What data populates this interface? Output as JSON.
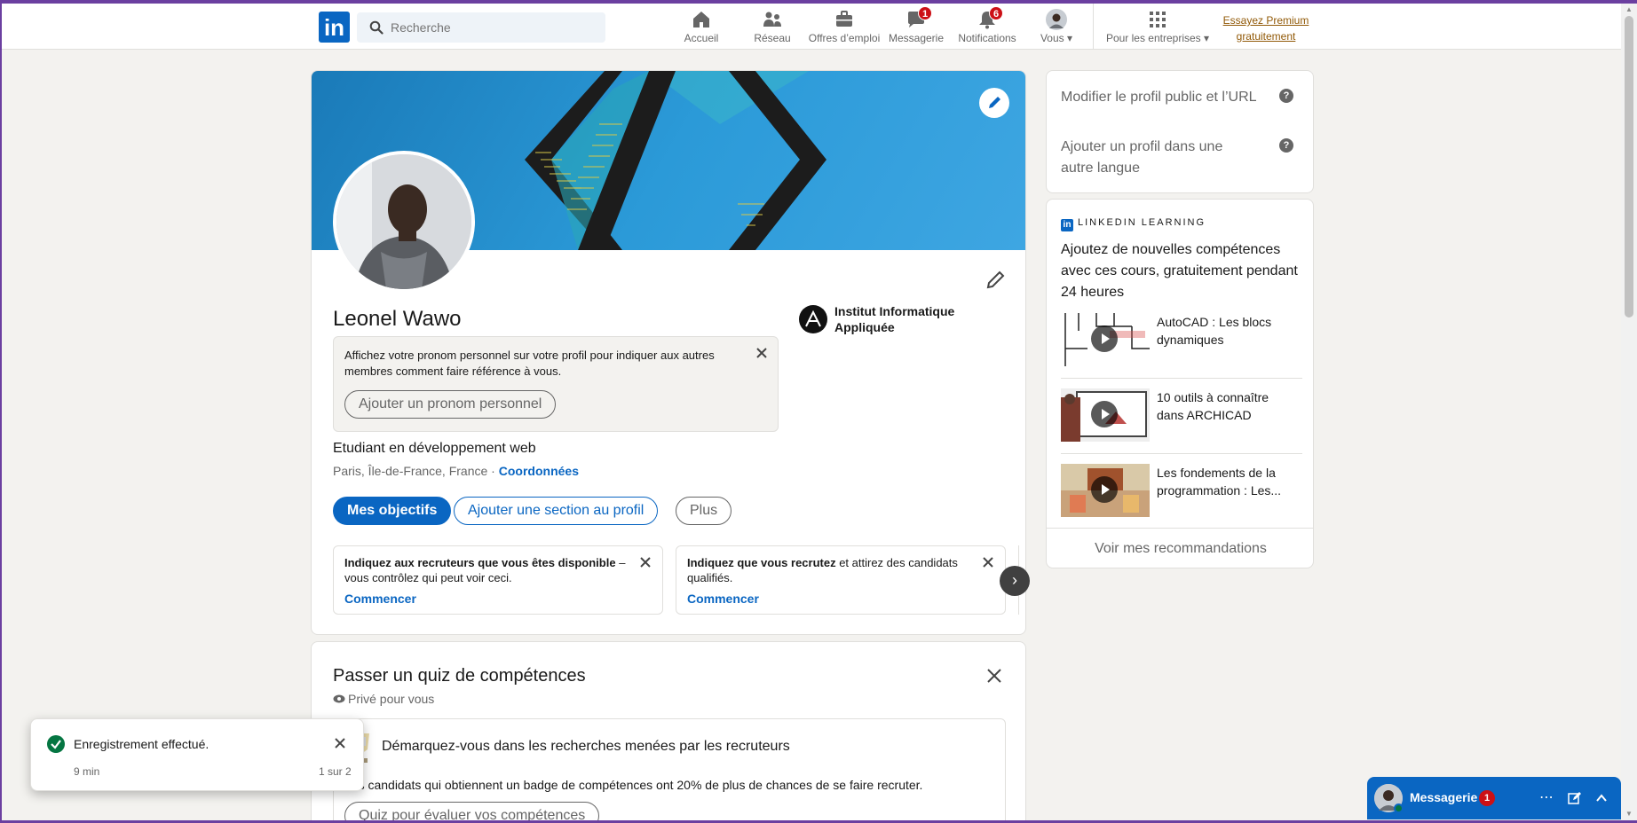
{
  "nav": {
    "search_placeholder": "Recherche",
    "items": [
      {
        "label": "Accueil",
        "icon": "home-icon"
      },
      {
        "label": "Réseau",
        "icon": "network-icon"
      },
      {
        "label": "Offres d’emploi",
        "icon": "jobs-icon"
      },
      {
        "label": "Messagerie",
        "icon": "messaging-icon",
        "badge": "1"
      },
      {
        "label": "Notifications",
        "icon": "bell-icon",
        "badge": "6"
      },
      {
        "label": "Vous",
        "icon": "me-avatar"
      },
      {
        "label": "Pour les entreprises",
        "icon": "grid-icon"
      }
    ],
    "premium_line1": "Essayez Premium",
    "premium_line2": "gratuitement"
  },
  "profile": {
    "name": "Leonel Wawo",
    "school": "Institut Informatique Appliquée",
    "pronoun_text": "Affichez votre pronom personnel sur votre profil pour indiquer aux autres membres comment faire référence à vous.",
    "pronoun_button": "Ajouter un pronom personnel",
    "headline": "Etudiant en développement web",
    "location": "Paris, Île-de-France, France",
    "location_sep": " · ",
    "contact_link": "Coordonnées",
    "btn_goals": "Mes objectifs",
    "btn_add_section": "Ajouter une section au profil",
    "btn_more": "Plus",
    "promo1_bold": "Indiquez aux recruteurs que vous êtes disponible",
    "promo1_rest": " – vous contrôlez qui peut voir ceci.",
    "promo1_cta": "Commencer",
    "promo2_bold": "Indiquez que vous recrutez",
    "promo2_rest": " et attirez des candidats qualifiés.",
    "promo2_cta": "Commencer"
  },
  "quiz": {
    "title": "Passer un quiz de compétences",
    "privacy": "Privé pour vous",
    "inner_title": "Démarquez-vous dans les recherches menées par les recruteurs",
    "description": "Les candidats qui obtiennent un badge de compétences ont 20% de plus de chances de se faire recruter.",
    "button": "Quiz pour évaluer vos compétences"
  },
  "sidebar": {
    "edit_public_profile": "Modifier le profil public et l’URL",
    "add_language_profile": "Ajouter un profil dans une autre langue",
    "learning_header": "LINKEDIN LEARNING",
    "learning_intro": "Ajoutez de nouvelles compétences avec ces cours, gratuitement pendant 24 heures",
    "courses": [
      {
        "title": "AutoCAD : Les blocs dynamiques"
      },
      {
        "title": "10 outils à connaître dans ARCHICAD"
      },
      {
        "title": "Les fondements de la programmation : Les..."
      }
    ],
    "see_recommendations": "Voir mes recommandations"
  },
  "toast": {
    "message": "Enregistrement effectué.",
    "time": "9 min",
    "count": "1 sur 2"
  },
  "messaging": {
    "label": "Messagerie",
    "badge": "1"
  },
  "colors": {
    "brand": "#0a66c2",
    "badge": "#cc1016",
    "success": "#057642",
    "premium": "#915907"
  }
}
